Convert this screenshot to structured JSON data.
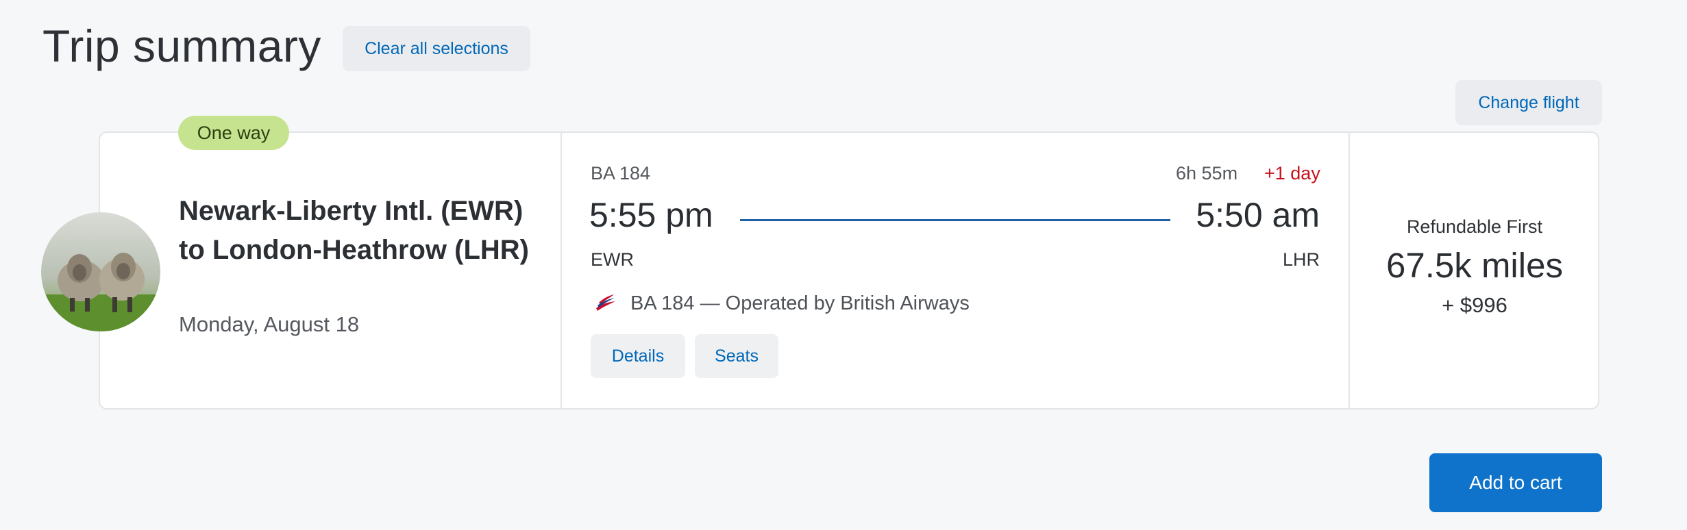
{
  "header": {
    "title": "Trip summary",
    "clear_label": "Clear all selections"
  },
  "actions": {
    "change_flight_label": "Change flight",
    "add_to_cart_label": "Add to cart"
  },
  "trip": {
    "badge": "One way",
    "route_title": "Newark-Liberty Intl. (EWR) to London-Heathrow (LHR)",
    "date": "Monday, August 18",
    "image_alt": "sheep-photo"
  },
  "flight": {
    "number": "BA 184",
    "duration": "6h 55m",
    "day_change": "+1 day",
    "departure_time": "5:55 pm",
    "arrival_time": "5:50 am",
    "departure_code": "EWR",
    "arrival_code": "LHR",
    "operated_by": "BA 184 — Operated by British Airways",
    "details_label": "Details",
    "seats_label": "Seats"
  },
  "fare": {
    "class": "Refundable First",
    "miles": "67.5k miles",
    "cash": "+ $996"
  },
  "colors": {
    "accent": "#0067b8",
    "primary_button": "#0f73cc",
    "badge": "#c6e48f",
    "day_change": "#c9111b",
    "flight_line": "#2361a6"
  }
}
